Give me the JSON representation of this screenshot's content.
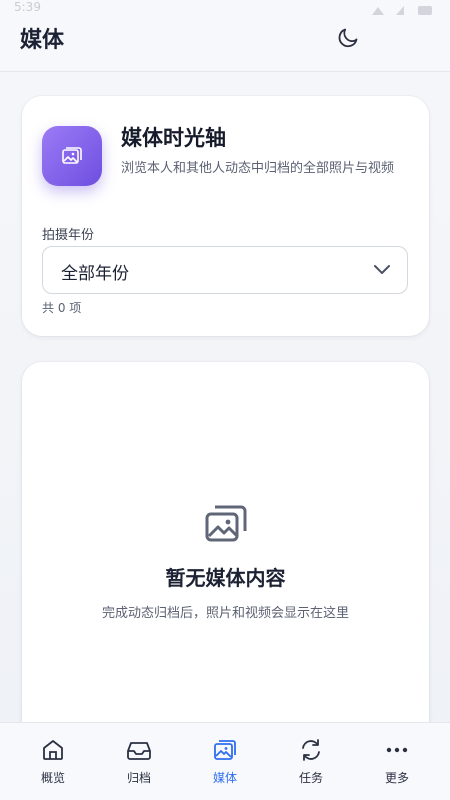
{
  "status_bar": {
    "time": "5:39"
  },
  "header": {
    "title": "媒体",
    "theme_icon": "moon-icon"
  },
  "info_card": {
    "icon": "image-icon",
    "title": "媒体时光轴",
    "description": "浏览本人和其他人动态中归档的全部照片与视频",
    "year_label": "拍摄年份",
    "year_select": {
      "value": "全部年份"
    },
    "count_text": "共 0 项"
  },
  "empty_state": {
    "icon": "images-icon",
    "title": "暂无媒体内容",
    "subtitle": "完成动态归档后，照片和视频会显示在这里"
  },
  "bottom_nav": {
    "active_color": "#2f6ff0",
    "items": [
      {
        "label": "概览",
        "icon": "home-icon"
      },
      {
        "label": "归档",
        "icon": "inbox-icon"
      },
      {
        "label": "媒体",
        "icon": "image-icon"
      },
      {
        "label": "任务",
        "icon": "sync-icon"
      },
      {
        "label": "更多",
        "icon": "more-icon"
      }
    ],
    "active_index": 2
  }
}
